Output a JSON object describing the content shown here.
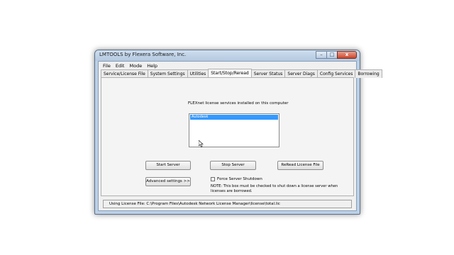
{
  "window": {
    "title": "LMTOOLS by Flexera Software, Inc.",
    "controls": {
      "minimize": "–",
      "maximize": "□",
      "close": "x"
    }
  },
  "menu": [
    "File",
    "Edit",
    "Mode",
    "Help"
  ],
  "tabs": [
    "Service/License File",
    "System Settings",
    "Utilities",
    "Start/Stop/Reread",
    "Server Status",
    "Server Diags",
    "Config Services",
    "Borrowing"
  ],
  "active_tab": "Start/Stop/Reread",
  "services": {
    "label": "FLEXnet license services installed on this computer",
    "selected_item": "Autodesk"
  },
  "buttons": {
    "start": "Start Server",
    "stop": "Stop Server",
    "reread": "ReRead License File",
    "advanced": "Advanced settings >>"
  },
  "force_shutdown": {
    "label": "Force Server Shutdown",
    "checked": false
  },
  "note": "NOTE:  This box must be checked to shut down a license server when licenses are borrowed.",
  "status": "Using License File:  C:\\Program Files\\Autodesk Network License Manager\\license\\total.lic"
}
